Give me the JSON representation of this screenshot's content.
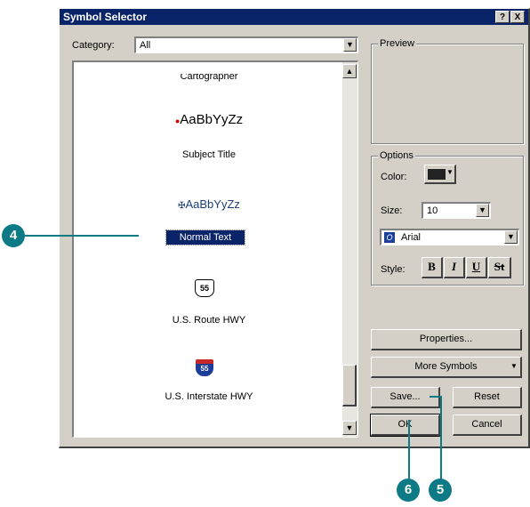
{
  "dialog": {
    "title": "Symbol Selector",
    "help_btn": "?",
    "close_btn": "X"
  },
  "category": {
    "label": "Category:",
    "value": "All"
  },
  "symbols": [
    {
      "name": "Cartographer"
    },
    {
      "name": "Subject Title",
      "sample": "AaBbYyZz"
    },
    {
      "name": "Normal Text",
      "sample": "AaBbYyZz"
    },
    {
      "name": "U.S. Route HWY",
      "shield": "55"
    },
    {
      "name": "U.S. Interstate HWY",
      "shield": "55"
    }
  ],
  "preview": {
    "label": "Preview"
  },
  "options": {
    "label": "Options",
    "color_label": "Color:",
    "size_label": "Size:",
    "size_value": "10",
    "font_value": "Arial",
    "style_label": "Style:",
    "style_buttons": [
      "B",
      "I",
      "U",
      "St"
    ]
  },
  "buttons": {
    "properties": "Properties...",
    "more_symbols": "More Symbols",
    "save": "Save...",
    "reset": "Reset",
    "ok": "OK",
    "cancel": "Cancel"
  },
  "callouts": [
    "4",
    "6",
    "5"
  ],
  "colors": {
    "title_bar": "#0a246a",
    "callout": "#0d7a86",
    "selection": "#0a246a",
    "color_swatch": "#222222"
  }
}
